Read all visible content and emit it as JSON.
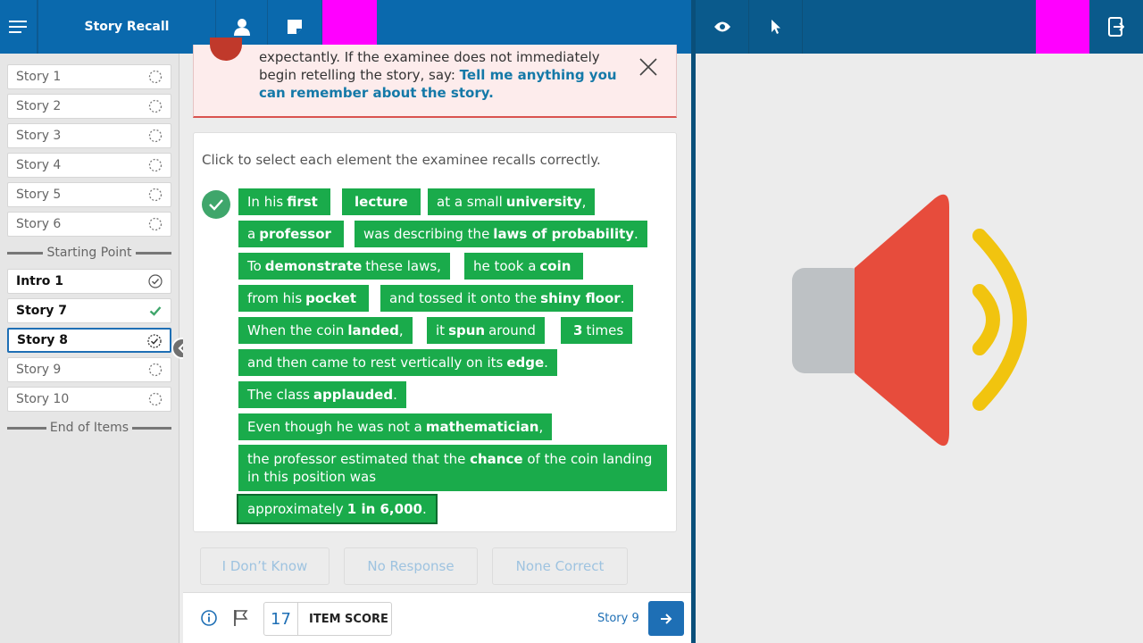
{
  "header": {
    "title": "Story Recall",
    "menu_icon": "hamburger-menu-icon",
    "user_icon": "user-icon",
    "notes_icon": "notes-icon",
    "eye_icon": "eye-icon",
    "pointer_icon": "pointer-icon",
    "exit_icon": "exit-device-icon"
  },
  "sidebar": {
    "items": [
      {
        "label": "Story 1"
      },
      {
        "label": "Story 2"
      },
      {
        "label": "Story 3"
      },
      {
        "label": "Story 4"
      },
      {
        "label": "Story 5"
      },
      {
        "label": "Story 6"
      }
    ],
    "starting_point": "Starting Point",
    "items2": [
      {
        "label": "Intro 1"
      },
      {
        "label": "Story 7"
      },
      {
        "label": "Story 8"
      },
      {
        "label": "Story 9"
      },
      {
        "label": "Story 10"
      }
    ],
    "end_label": "End of Items"
  },
  "alert": {
    "line1": "expectantly. If the examinee does not immediately",
    "line2_plain": "begin retelling the story, say: ",
    "line2_bold": "Tell me anything you can remember about the story."
  },
  "card": {
    "instruction": "Click to select each element the examinee recalls correctly.",
    "chips": [
      {
        "pre": "In his",
        "bold": "first",
        "post": ""
      },
      {
        "pre": "",
        "bold": "lecture",
        "post": ""
      },
      {
        "pre": "at a small",
        "bold": "university",
        "post": ","
      },
      {
        "pre": "a",
        "bold": "professor",
        "post": ""
      },
      {
        "pre": "was describing the",
        "bold": "laws of probability",
        "post": "."
      },
      {
        "pre": "To",
        "bold": "demonstrate",
        "post": "these laws,"
      },
      {
        "pre": "he took a",
        "bold": "coin",
        "post": ""
      },
      {
        "pre": "from his",
        "bold": "pocket",
        "post": ""
      },
      {
        "pre": "and tossed it onto the",
        "bold": "shiny floor",
        "post": "."
      },
      {
        "pre": "When the coin",
        "bold": "landed",
        "post": ","
      },
      {
        "pre": "it",
        "bold": "spun",
        "post": "around"
      },
      {
        "pre": "",
        "bold": "3",
        "post": "times"
      },
      {
        "pre": "and then came to rest vertically on its",
        "bold": "edge",
        "post": "."
      },
      {
        "pre": "The class",
        "bold": "applauded",
        "post": "."
      },
      {
        "pre": "Even though he was not a",
        "bold": "mathematician",
        "post": ","
      },
      {
        "pre": "the professor estimated that the",
        "bold": "chance",
        "post": "of the coin landing in this position was"
      },
      {
        "pre": "approximately",
        "bold": "1 in 6,000",
        "post": "."
      }
    ]
  },
  "responses": {
    "dont_know": "I Don’t Know",
    "no_response": "No Response",
    "none_correct": "None Correct"
  },
  "footer": {
    "score": "17",
    "score_label": "ITEM SCORE",
    "next_label": "Story 9"
  },
  "colors": {
    "header_blue": "#0a69ad",
    "chip_green": "#1aab4b",
    "speaker_red": "#e74c3c",
    "speaker_yellow": "#f1c40f"
  }
}
